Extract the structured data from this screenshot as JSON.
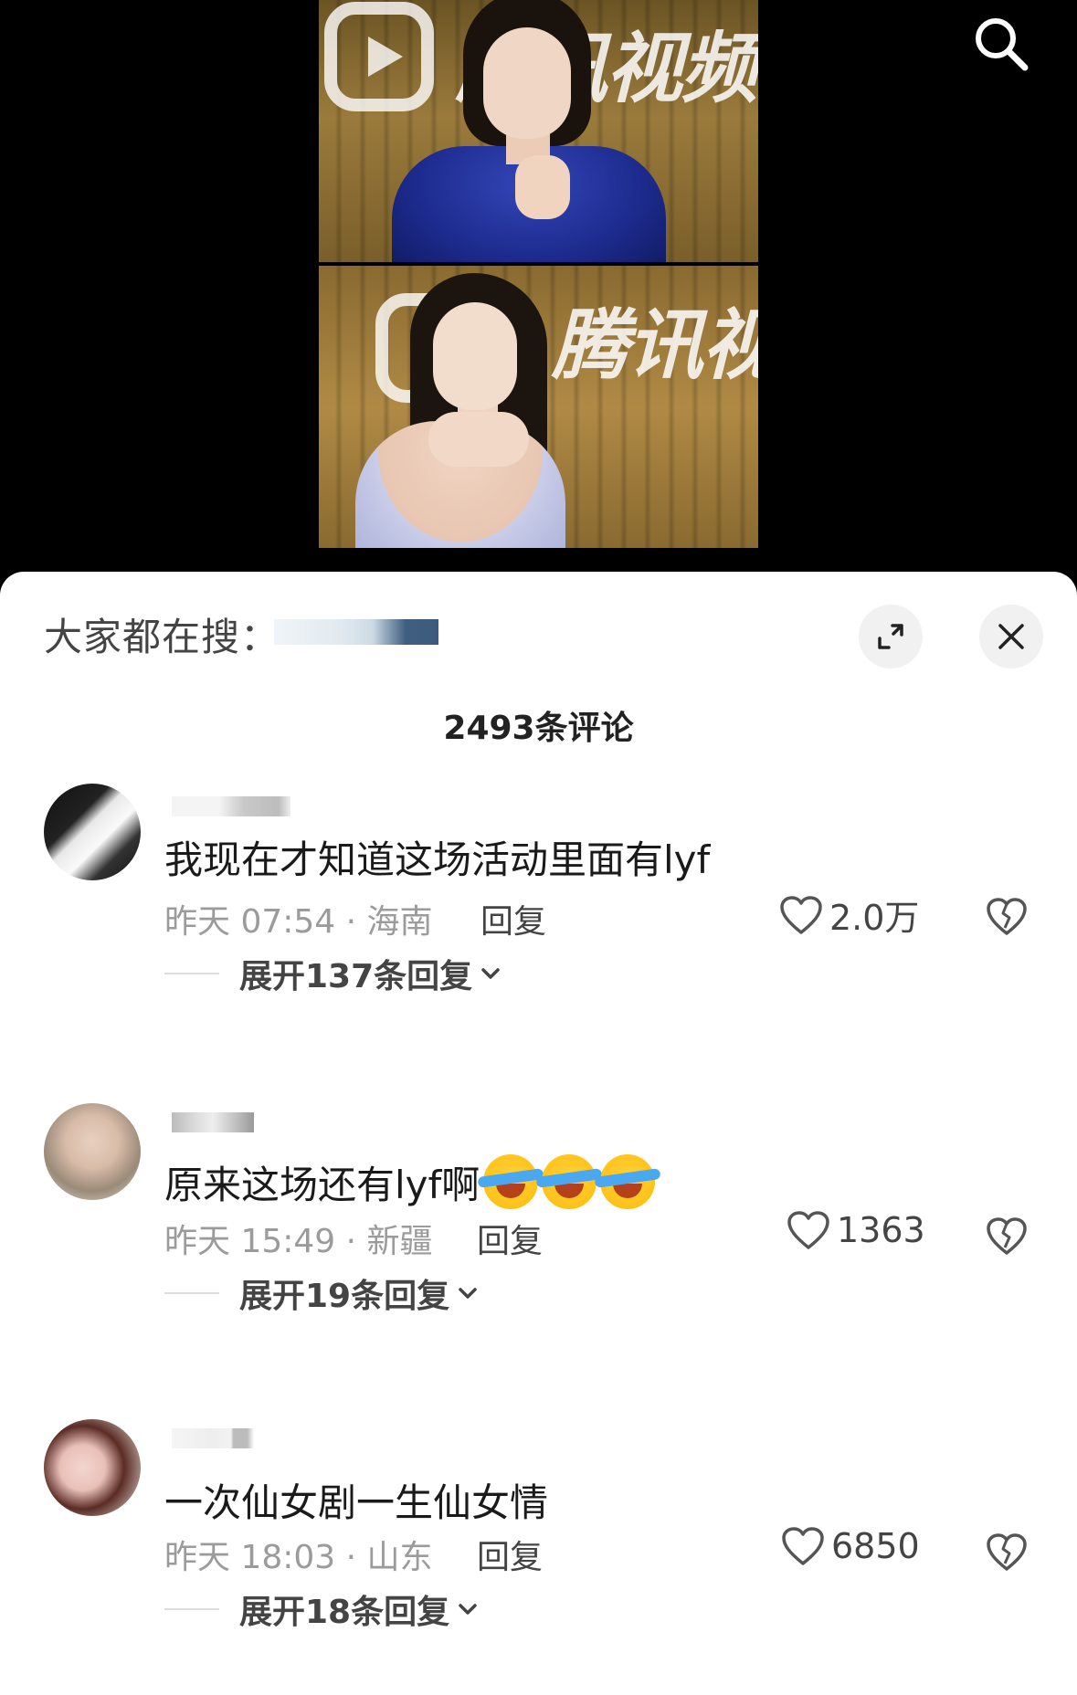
{
  "sheet": {
    "trending_label": "大家都在搜：",
    "comment_count_title": "2493条评论"
  },
  "comments": [
    {
      "text": "我现在才知道这场活动里面有lyf",
      "time_location": "昨天 07:54 · 海南",
      "reply_label": "回复",
      "likes": "2.0万",
      "expand_label": "展开137条回复",
      "emoji_count": 0
    },
    {
      "text": "原来这场还有lyf啊",
      "time_location": "昨天 15:49 · 新疆",
      "reply_label": "回复",
      "likes": "1363",
      "expand_label": "展开19条回复",
      "emoji_count": 3,
      "emoji_name": "laughing-crying-emoji"
    },
    {
      "text": "一次仙女剧一生仙女情",
      "time_location": "昨天 18:03 · 山东",
      "reply_label": "回复",
      "likes": "6850",
      "expand_label": "展开18条回复",
      "emoji_count": 0
    }
  ],
  "video": {
    "logo_text_top": "腾讯视频",
    "logo_text_bottom": "腾讯视"
  },
  "colors": {
    "sheet_bg": "#ffffff",
    "meta_gray": "#9b9b9b",
    "text_dark": "#1a1a1a"
  }
}
